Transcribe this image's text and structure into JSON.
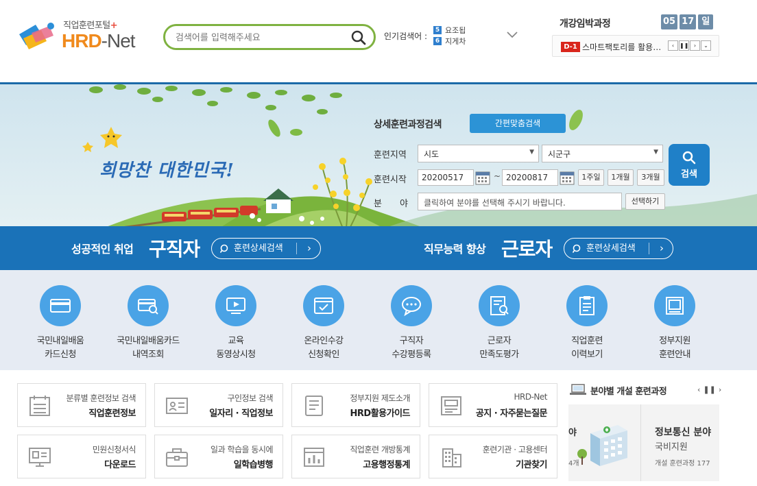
{
  "header": {
    "logo_sub": "직업훈련포털",
    "logo_plus": "+",
    "logo_hrd": "HRD",
    "logo_net": "-Net",
    "search_placeholder": "검색어를 입력해주세요",
    "popular_label": "인기검색어 :",
    "popular_items": [
      {
        "rank": "5",
        "text": "요조됩"
      },
      {
        "rank": "6",
        "text": "지게차"
      }
    ],
    "upcoming_title": "개강임박과정",
    "date_month": "05",
    "date_day": "17",
    "date_weekday": "일",
    "dday": "D-1",
    "upcoming_course": "스마트팩토리를 활용한..."
  },
  "search_panel": {
    "title": "상세훈련과정검색",
    "simple_button": "간편맞춤검색",
    "region_label": "훈련지역",
    "region_select": "시도",
    "district_select": "시군구",
    "start_label": "훈련시작",
    "date_from": "20200517",
    "date_sep": "~",
    "date_to": "20200817",
    "period_1w": "1주일",
    "period_1m": "1개월",
    "period_3m": "3개월",
    "field_label": "분　　야",
    "field_placeholder": "클릭하여 분야를 선택해 주시기 바랍니다.",
    "choose_button": "선택하기",
    "search_button": "검색",
    "slogan": "희망찬 대한민국!"
  },
  "band": {
    "left_sub": "성공적인 취업",
    "left_main": "구직자",
    "left_button": "훈련상세검색",
    "right_sub": "직무능력 향상",
    "right_main": "근로자",
    "right_button": "훈련상세검색"
  },
  "icon_menu": [
    {
      "line1": "국민내일배움",
      "line2": "카드신청",
      "icon": "card-icon"
    },
    {
      "line1": "국민내일배움카드",
      "line2": "내역조회",
      "icon": "card-search-icon"
    },
    {
      "line1": "교육",
      "line2": "동영상시청",
      "icon": "video-icon"
    },
    {
      "line1": "온라인수강",
      "line2": "신청확인",
      "icon": "online-check-icon"
    },
    {
      "line1": "구직자",
      "line2": "수강평등록",
      "icon": "chat-icon"
    },
    {
      "line1": "근로자",
      "line2": "만족도평가",
      "icon": "survey-icon"
    },
    {
      "line1": "직업훈련",
      "line2": "이력보기",
      "icon": "history-icon"
    },
    {
      "line1": "정부지원",
      "line2": "훈련안내",
      "icon": "book-icon"
    }
  ],
  "quick_links": [
    {
      "sub": "분류별 훈련정보 검색",
      "main": "직업훈련정보",
      "icon": "calendar-list-icon"
    },
    {
      "sub": "구인정보 검색",
      "main": "일자리 · 직업정보",
      "icon": "id-card-icon"
    },
    {
      "sub": "정부지원 제도소개",
      "main": "HRD활용가이드",
      "icon": "guide-book-icon"
    },
    {
      "sub": "HRD-Net",
      "main": "공지 · 자주묻는질문",
      "icon": "notice-icon"
    },
    {
      "sub": "민원신청서식",
      "main": "다운로드",
      "icon": "monitor-doc-icon"
    },
    {
      "sub": "일과 학습을 동시에",
      "main": "일학습병행",
      "icon": "briefcase-icon"
    },
    {
      "sub": "직업훈련 개방통계",
      "main": "고용행정통계",
      "icon": "stats-icon"
    },
    {
      "sub": "훈련기관 · 고용센터",
      "main": "기관찾기",
      "icon": "building-icon"
    }
  ],
  "field_courses": {
    "title": "분야별 개설 훈련과정",
    "prev_edge_title": "야",
    "prev_edge_count": "4개",
    "card_title": "정보통신 분야",
    "card_sub": "국비지원",
    "card_count": "개설 훈련과정 177"
  },
  "colors": {
    "brand_orange": "#f08a1d",
    "search_green": "#7fb241",
    "band_blue": "#1a72b8",
    "icon_blue": "#4aa3e6",
    "dday_red": "#d9261c"
  }
}
